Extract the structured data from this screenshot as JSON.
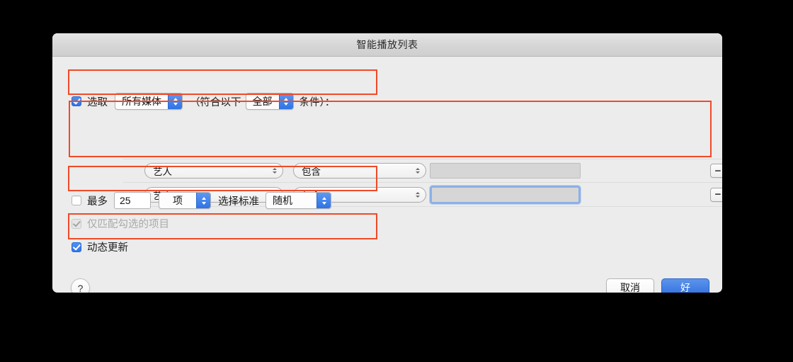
{
  "window": {
    "title": "智能播放列表"
  },
  "match_row": {
    "checkbox_checked": true,
    "label": "选取",
    "source_select": {
      "value": "所有媒体"
    },
    "paren_open_text": "（符合以下",
    "logic_select": {
      "value": "全部"
    },
    "paren_close_text": "条件）：",
    "icon": "chevron-updown-icon"
  },
  "rules": [
    {
      "field": "艺人",
      "operator": "包含",
      "value": "",
      "focused": false,
      "remove_label": "−",
      "add_label": "+"
    },
    {
      "field": "艺人",
      "operator": "包含",
      "value": "",
      "focused": true,
      "remove_label": "−",
      "add_label": "+"
    }
  ],
  "limit_row": {
    "checkbox_checked": false,
    "label": "最多",
    "amount": "25",
    "unit_select": {
      "value": "项"
    },
    "selected_by_label": "选择标准",
    "order_select": {
      "value": "随机"
    }
  },
  "match_only_checked_row": {
    "checkbox_checked": true,
    "disabled": true,
    "label": "仅匹配勾选的项目"
  },
  "live_update_row": {
    "checkbox_checked": true,
    "label": "动态更新"
  },
  "footer": {
    "help_label": "?",
    "cancel_label": "取消",
    "ok_label": "好"
  },
  "colors": {
    "accent_blue": "#2f74e8",
    "annotation_red": "#f04a28",
    "dialog_bg": "#ececec",
    "titlebar_bg": "#d6d6d6"
  }
}
